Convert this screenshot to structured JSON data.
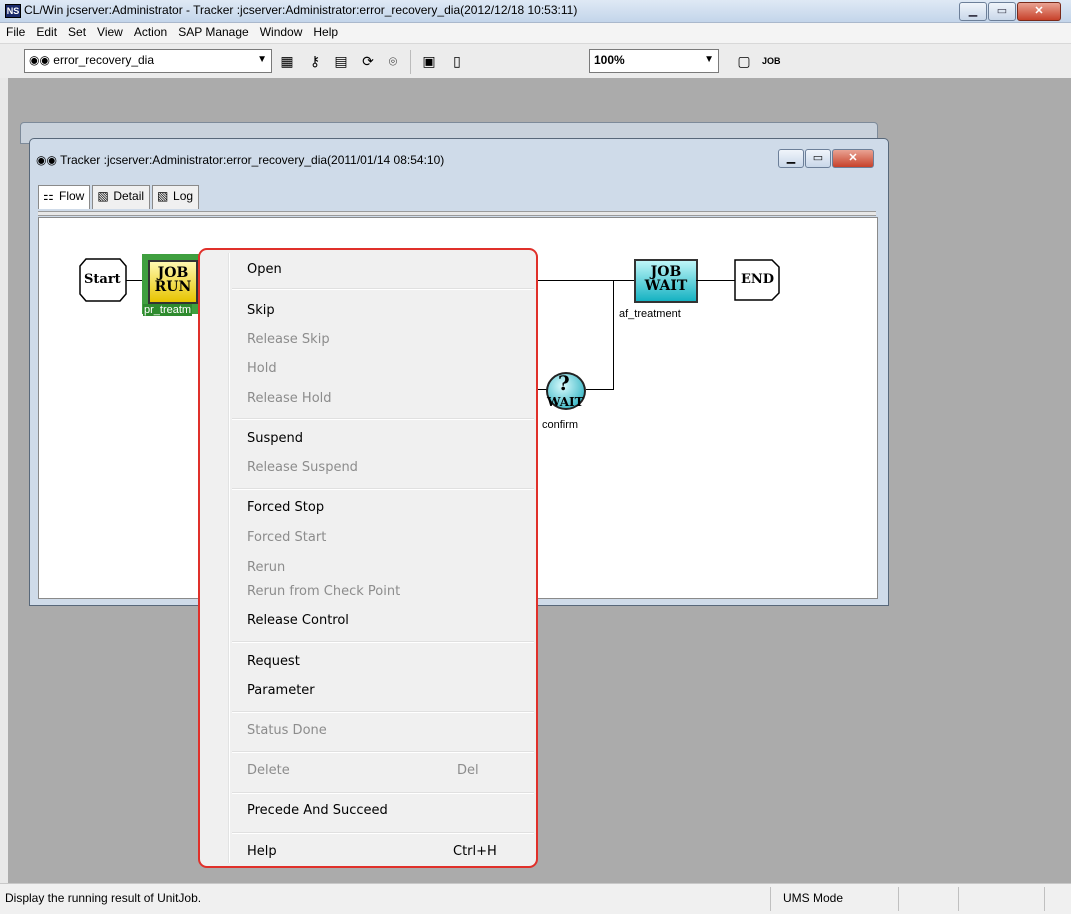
{
  "window": {
    "title": "CL/Win jcserver:Administrator - Tracker :jcserver:Administrator:error_recovery_dia(2012/12/18 10:53:11)",
    "app_icon": "NS"
  },
  "menubar": [
    "File",
    "Edit",
    "Set",
    "View",
    "Action",
    "SAP Manage",
    "Window",
    "Help"
  ],
  "toolbar": {
    "object_combo": "error_recovery_dia",
    "zoom": "100%",
    "icons": [
      "flow-map-icon",
      "key-search-icon",
      "schedule-icon",
      "refresh-icon",
      "binoculars-icon",
      "print-preview-icon",
      "page-icon",
      "help-f1-icon",
      "job-icon"
    ]
  },
  "tracker": {
    "title": "Tracker :jcserver:Administrator:error_recovery_dia(2011/01/14 08:54:10)",
    "tabs": [
      "Flow",
      "Detail",
      "Log"
    ]
  },
  "flow": {
    "start": "Start",
    "end": "END",
    "job1": {
      "line1": "JOB",
      "line2": "RUN",
      "label": "pr_treatm"
    },
    "job2": {
      "line1": "JOB",
      "line2": "WAIT",
      "label": "af_treatment"
    },
    "wait": {
      "symbol": "?",
      "text": "WAIT",
      "label": "confirm"
    }
  },
  "context_menu": {
    "items": [
      {
        "label": "Open",
        "enabled": true
      },
      {
        "label": "Skip",
        "enabled": true
      },
      {
        "label": "Release Skip",
        "enabled": false
      },
      {
        "label": "Hold",
        "enabled": false
      },
      {
        "label": "Release Hold",
        "enabled": false
      },
      {
        "label": "Suspend",
        "enabled": true
      },
      {
        "label": "Release Suspend",
        "enabled": false
      },
      {
        "label": "Forced Stop",
        "enabled": true
      },
      {
        "label": "Forced Start",
        "enabled": false
      },
      {
        "label": "Rerun",
        "enabled": false
      },
      {
        "label": "Rerun from Check Point",
        "enabled": false
      },
      {
        "label": "Release Control",
        "enabled": true
      },
      {
        "label": "Request",
        "enabled": true
      },
      {
        "label": "Parameter",
        "enabled": true
      },
      {
        "label": "Status Done",
        "enabled": false
      },
      {
        "label": "Delete",
        "enabled": false,
        "shortcut": "Del"
      },
      {
        "label": "Precede And Succeed",
        "enabled": true
      },
      {
        "label": "Help",
        "enabled": true,
        "shortcut": "Ctrl+H"
      }
    ]
  },
  "status": {
    "message": "Display the running result of UnitJob.",
    "mode": "UMS Mode"
  }
}
